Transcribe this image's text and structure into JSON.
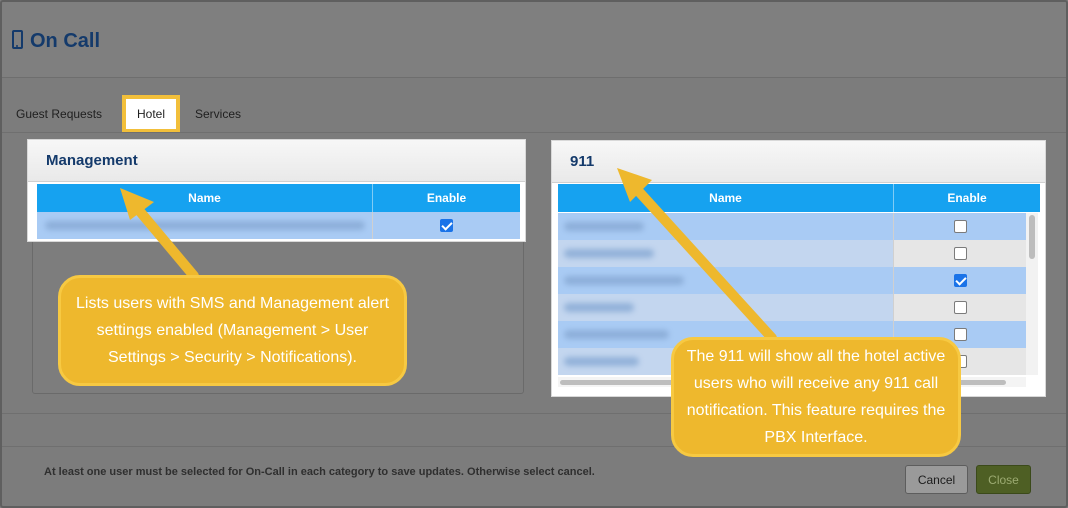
{
  "header": {
    "title": "On Call",
    "icon": "mobile-phone-icon"
  },
  "tabs": [
    {
      "label": "Guest Requests"
    },
    {
      "label": "Hotel"
    },
    {
      "label": "Services"
    }
  ],
  "management": {
    "title": "Management",
    "columns": {
      "name": "Name",
      "enable": "Enable"
    },
    "rows": [
      {
        "name": "",
        "enabled": true
      }
    ]
  },
  "e911": {
    "title": "911",
    "columns": {
      "name": "Name",
      "enable": "Enable"
    },
    "rows": [
      {
        "name": "",
        "enabled": false
      },
      {
        "name": "",
        "enabled": false
      },
      {
        "name": "",
        "enabled": true
      },
      {
        "name": "",
        "enabled": false
      },
      {
        "name": "",
        "enabled": false
      },
      {
        "name": "",
        "enabled": false
      }
    ]
  },
  "footer": {
    "note": "At least one user must be selected for On-Call in each category to save updates. Otherwise select cancel.",
    "cancel_label": "Cancel",
    "close_label": "Close"
  },
  "callouts": {
    "management": "Lists users with SMS and Management alert settings enabled (Management > User Settings > Security > Notifications).",
    "e911": "The 911 will show all the hotel active users who will receive any 911 call notification. This feature requires the PBX Interface."
  },
  "colors": {
    "accent": "#f2bf3a",
    "grid_header": "#16a2f0",
    "row_highlight": "#a9cbf4",
    "title_blue": "#143a6b",
    "close_button": "#4e5f24"
  }
}
